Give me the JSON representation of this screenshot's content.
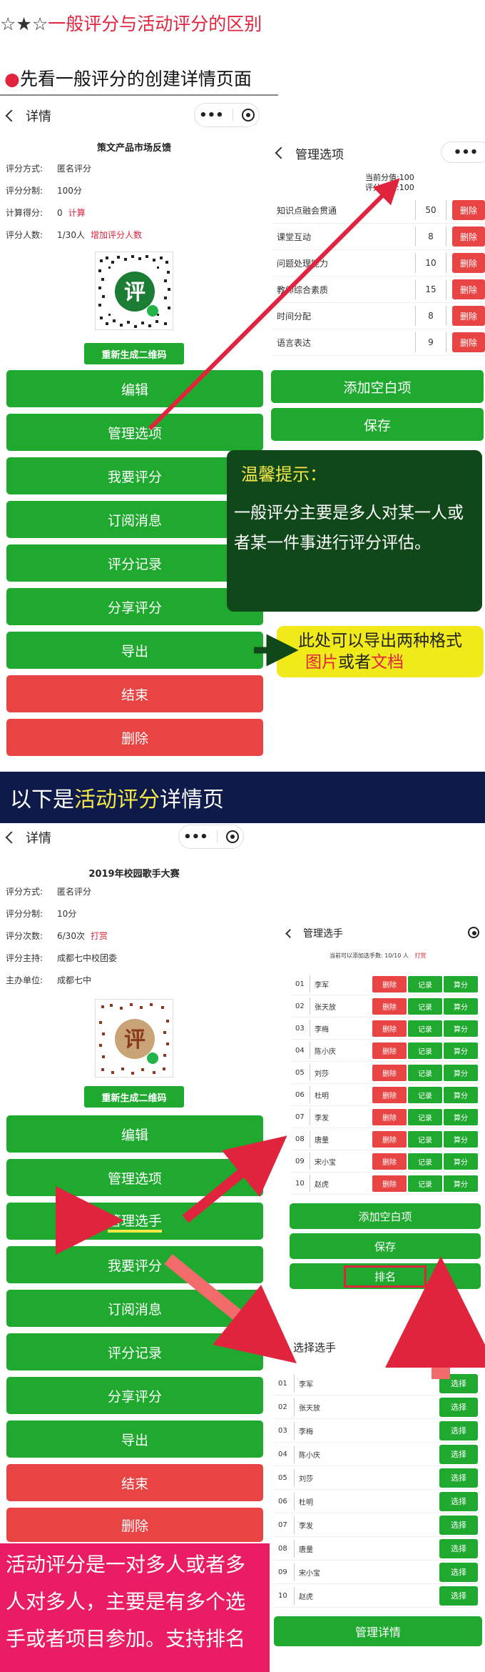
{
  "header": {
    "stars": "☆★☆",
    "title": "一般评分与活动评分的区别",
    "section1": "先看一般评分的创建详情页面"
  },
  "general": {
    "nav_title": "详情",
    "capsule_dots": "•••",
    "page_title": "策文产品市场反馈",
    "rows": [
      {
        "k": "评分方式:",
        "v": "匿名评分",
        "extra": ""
      },
      {
        "k": "评分分制:",
        "v": "100分",
        "extra": ""
      },
      {
        "k": "计算得分:",
        "v": "0",
        "extra": "计算"
      },
      {
        "k": "评分人数:",
        "v": "1/30人",
        "extra": "增加评分人数"
      }
    ],
    "qr_char": "评",
    "regen_label": "重新生成二维码",
    "buttons": [
      "编辑",
      "管理选项",
      "我要评分",
      "订阅消息",
      "评分记录",
      "分享评分",
      "导出",
      "结束",
      "删除"
    ]
  },
  "manage_options": {
    "nav_title": "管理选项",
    "current_total": "当前分值:100",
    "scale": "评分分制:100",
    "items": [
      {
        "name": "知识点融会贯通",
        "score": "50"
      },
      {
        "name": "课堂互动",
        "score": "8"
      },
      {
        "name": "问题处理能力",
        "score": "10"
      },
      {
        "name": "教师综合素质",
        "score": "15"
      },
      {
        "name": "时间分配",
        "score": "8"
      },
      {
        "name": "语言表达",
        "score": "9"
      }
    ],
    "delete_label": "删除",
    "add_label": "添加空白项",
    "save_label": "保存"
  },
  "tip": {
    "heading": "温馨提示：",
    "body": "一般评分主要是多人对某一人或者某一件事进行评分评估。"
  },
  "export_note": {
    "line1": "此处可以导出两种格式",
    "img": "图片",
    "or": "或者",
    "doc": "文档"
  },
  "banner": {
    "prefix": "以下是",
    "mid": "活动评分",
    "suffix": "详情页"
  },
  "activity": {
    "nav_title": "详情",
    "page_title": "2019年校园歌手大赛",
    "rows": [
      {
        "k": "评分方式:",
        "v": "匿名评分",
        "extra": ""
      },
      {
        "k": "评分分制:",
        "v": "10分",
        "extra": ""
      },
      {
        "k": "评分次数:",
        "v": "6/30次",
        "extra": "打赏"
      },
      {
        "k": "评分主持:",
        "v": "成都七中校团委",
        "extra": ""
      },
      {
        "k": "主办单位:",
        "v": "成都七中",
        "extra": ""
      }
    ],
    "qr_char": "评",
    "regen_label": "重新生成二维码",
    "buttons": [
      "编辑",
      "管理选项",
      "管理选手",
      "我要评分",
      "订阅消息",
      "评分记录",
      "分享评分",
      "导出",
      "结束",
      "删除"
    ]
  },
  "manage_players": {
    "nav_title": "管理选手",
    "hint": "当前可以添加选手数: 10/10 人",
    "hint_extra": "打赏",
    "players": [
      {
        "no": "01",
        "name": "李军"
      },
      {
        "no": "02",
        "name": "张天放"
      },
      {
        "no": "03",
        "name": "李梅"
      },
      {
        "no": "04",
        "name": "陈小庆"
      },
      {
        "no": "05",
        "name": "刘莎"
      },
      {
        "no": "06",
        "name": "杜明"
      },
      {
        "no": "07",
        "name": "李发"
      },
      {
        "no": "08",
        "name": "唐量"
      },
      {
        "no": "09",
        "name": "宋小宝"
      },
      {
        "no": "10",
        "name": "赵虎"
      }
    ],
    "btn_delete": "删除",
    "btn_record": "记录",
    "btn_score": "算分",
    "add_label": "添加空白项",
    "save_label": "保存",
    "rank_label": "排名"
  },
  "choose_players": {
    "nav_title": "选择选手",
    "select_label": "选择",
    "detail_label": "管理详情"
  },
  "summary": {
    "text": "活动评分是一对多人或者多人对多人，主要是有多个选手或者项目参加。支持排名"
  }
}
